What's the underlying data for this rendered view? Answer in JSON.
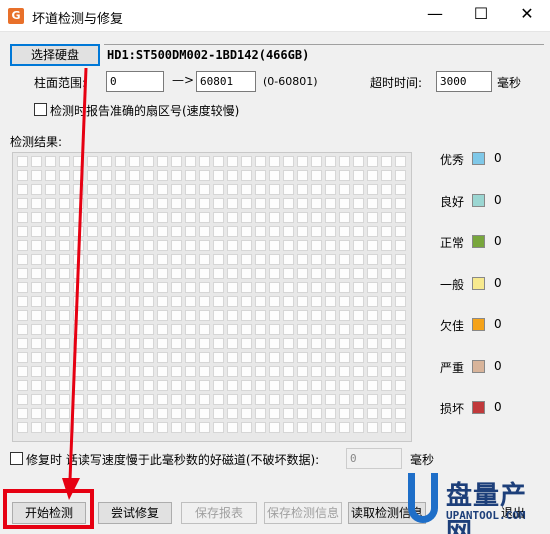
{
  "window": {
    "title": "坏道检测与修复",
    "app_icon_letter": "G",
    "controls": {
      "minimize": "—",
      "maximize": "☐",
      "close": "✕"
    }
  },
  "disk": {
    "select_button": "选择硬盘",
    "info": "HD1:ST500DM002-1BD142(466GB)"
  },
  "range": {
    "label": "柱面范围:",
    "start": "0",
    "arrow": "—>",
    "end": "60801",
    "hint": "(0-60801)"
  },
  "timeout": {
    "label": "超时时间:",
    "value": "3000",
    "unit": "毫秒"
  },
  "report_option": {
    "label": "检测时报告准确的扇区号(速度较慢)",
    "checked": false
  },
  "results": {
    "label": "检测结果:",
    "grid_rows": 20,
    "grid_cols": 28
  },
  "legend": [
    {
      "label": "优秀",
      "color": "#7fc8e8",
      "count": "0"
    },
    {
      "label": "良好",
      "color": "#9bd6d2",
      "count": "0"
    },
    {
      "label": "正常",
      "color": "#78a63c",
      "count": "0"
    },
    {
      "label": "一般",
      "color": "#f7e98e",
      "count": "0"
    },
    {
      "label": "欠佳",
      "color": "#f5a31a",
      "count": "0"
    },
    {
      "label": "严重",
      "color": "#d8b49a",
      "count": "0"
    },
    {
      "label": "损坏",
      "color": "#c0393b",
      "count": "0"
    }
  ],
  "repair_option": {
    "label": "修复时     话读写速度慢于此毫秒数的好磁道(不破坏数据):",
    "value": "0",
    "unit": "毫秒",
    "checked": false
  },
  "buttons": {
    "start": "开始检测",
    "try_repair": "尝试修复",
    "save_report": "保存报表",
    "save_info": "保存检测信息",
    "read_info": "读取检测信息",
    "exit": "退出"
  },
  "watermark": {
    "cn": "盘量产网",
    "en": "UPANTOOL.COM"
  },
  "annotation_colors": {
    "highlight": "#e60012"
  }
}
